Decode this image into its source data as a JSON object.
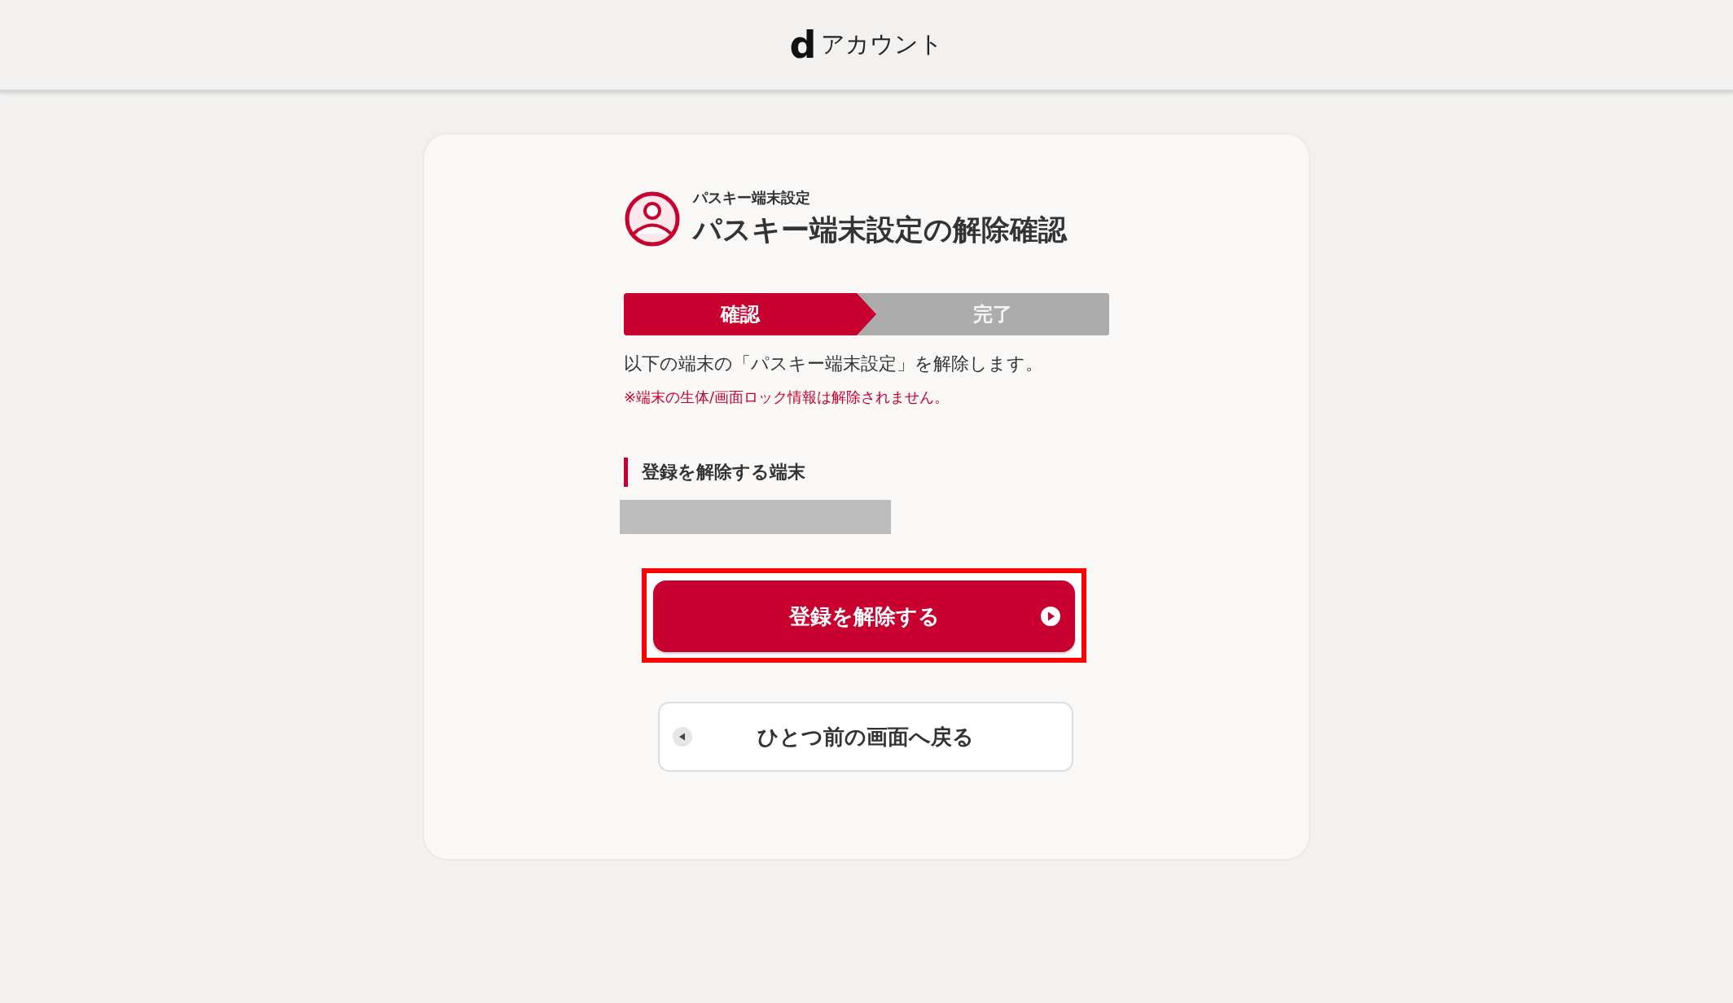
{
  "header": {
    "logo": "d",
    "title": "アカウント"
  },
  "page": {
    "subtitle": "パスキー端末設定",
    "title": "パスキー端末設定の解除確認"
  },
  "steps": [
    {
      "label": "確認",
      "selected": true
    },
    {
      "label": "完了",
      "selected": false
    }
  ],
  "description": "以下の端末の「パスキー端末設定」を解除します。",
  "note": "※端末の生体/画面ロック情報は解除されません。",
  "section": {
    "heading": "登録を解除する端末"
  },
  "primary_button": {
    "label": "登録を解除する",
    "highlighted": true
  },
  "back_button": {
    "label": "ひとつ前の画面へ戻る"
  }
}
